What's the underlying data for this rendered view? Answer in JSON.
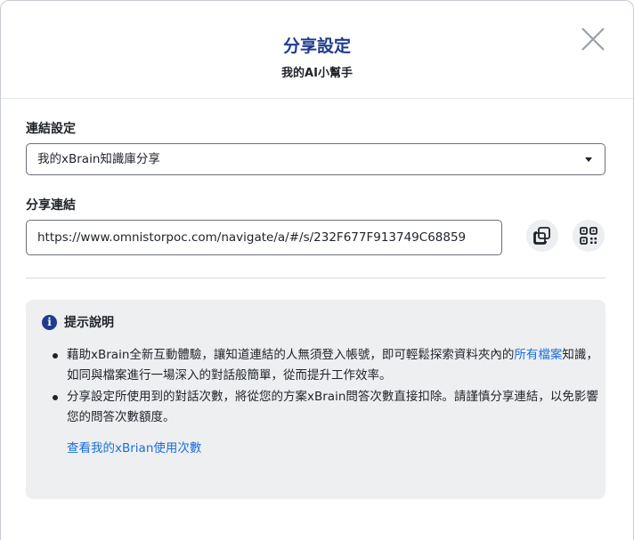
{
  "header": {
    "title": "分享設定",
    "subtitle": "我的AI小幫手"
  },
  "link_setting": {
    "label": "連結設定",
    "selected": "我的xBrain知識庫分享"
  },
  "share_link": {
    "label": "分享連結",
    "url": "https://www.omnistorpoc.com/navigate/a/#/s/232F677F913749C68859"
  },
  "icons": {
    "close": "close-icon",
    "copy": "copy-icon",
    "qr": "qr-code-icon",
    "info": "info-icon"
  },
  "notice": {
    "title": "提示說明",
    "item1_before": "藉助xBrain全新互動體驗，讓知道連結的人無須登入帳號，即可輕鬆探索資料夾內的",
    "item1_link": "所有檔案",
    "item1_after": "知識，如同與檔案進行一場深入的對話般簡單，從而提升工作效率。",
    "item2": "分享設定所使用到的對話次數，將從您的方案xBrain問答次數直接扣除。請謹慎分享連結，以免影響您的問答次數額度。",
    "usage_link": "查看我的xBrian使用次數"
  },
  "colors": {
    "title": "#1f3b8f",
    "link": "#1a6fdb",
    "notice_bg": "#eeeff1"
  }
}
